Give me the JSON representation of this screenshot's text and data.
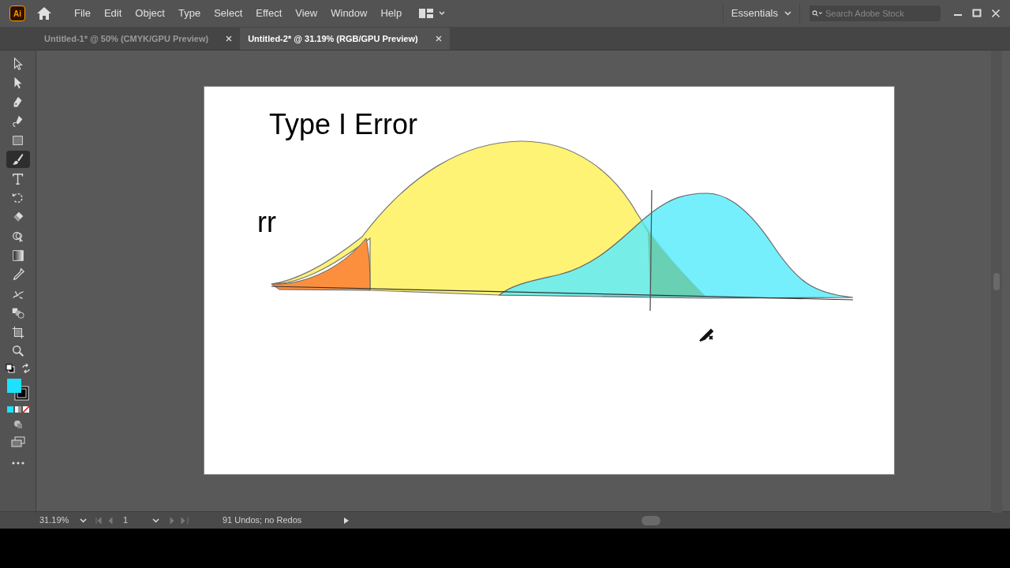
{
  "app": {
    "logo": "Ai"
  },
  "menu": [
    "File",
    "Edit",
    "Object",
    "Type",
    "Select",
    "Effect",
    "View",
    "Window",
    "Help"
  ],
  "workspace": "Essentials",
  "search": {
    "placeholder": "Search Adobe Stock"
  },
  "tabs": [
    {
      "label": "Untitled-1* @ 50% (CMYK/GPU Preview)",
      "selected": false
    },
    {
      "label": "Untitled-2* @ 31.19% (RGB/GPU Preview)",
      "selected": true
    }
  ],
  "tools": [
    {
      "kind": "selection",
      "selected": false
    },
    {
      "kind": "direct",
      "selected": false
    },
    {
      "kind": "pen",
      "selected": false
    },
    {
      "kind": "curvature",
      "selected": false
    },
    {
      "kind": "rectangle",
      "selected": false
    },
    {
      "kind": "paintbrush",
      "selected": true
    },
    {
      "kind": "type",
      "selected": false
    },
    {
      "kind": "rotate",
      "selected": false
    },
    {
      "kind": "eraser",
      "selected": false
    },
    {
      "kind": "shapebuilder",
      "selected": false
    },
    {
      "kind": "gradient",
      "selected": false
    },
    {
      "kind": "eyedropper",
      "selected": false
    },
    {
      "kind": "puppet",
      "selected": false
    },
    {
      "kind": "blend",
      "selected": false
    },
    {
      "kind": "artboard",
      "selected": false
    },
    {
      "kind": "zoom",
      "selected": false
    }
  ],
  "artboard": {
    "texts": [
      {
        "kind": "title",
        "text": "Type I Error"
      },
      {
        "kind": "label",
        "text": "rr"
      }
    ]
  },
  "status_bar": {
    "zoom": "31.19%",
    "artboard": "1",
    "message": "91 Undos; no Redos"
  }
}
